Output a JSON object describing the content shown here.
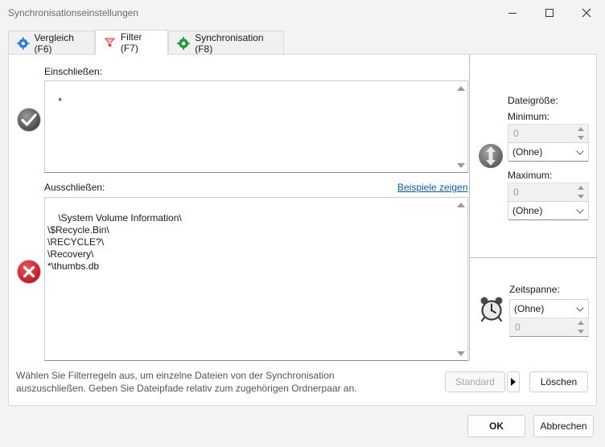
{
  "window": {
    "title": "Synchronisationseinstellungen"
  },
  "tabs": [
    {
      "label": "Vergleich (F6)",
      "icon": "gear-blue-icon"
    },
    {
      "label": "Filter (F7)",
      "icon": "funnel-red-icon",
      "active": true
    },
    {
      "label": "Synchronisation (F8)",
      "icon": "gear-green-icon"
    }
  ],
  "include": {
    "label": "Einschließen:",
    "text": "*"
  },
  "exclude": {
    "label": "Ausschließen:",
    "examples_link": "Beispiele zeigen",
    "text": "\\System Volume Information\\\n\\$Recycle.Bin\\\n\\RECYCLE?\\\n\\Recovery\\\n*\\thumbs.db"
  },
  "filesize": {
    "label": "Dateigröße:",
    "min_label": "Minimum:",
    "min_value": "0",
    "min_unit": "(Ohne)",
    "max_label": "Maximum:",
    "max_value": "0",
    "max_unit": "(Ohne)"
  },
  "timespan": {
    "label": "Zeitspanne:",
    "select": "(Ohne)",
    "value": "0"
  },
  "hint": "Wählen Sie Filterregeln aus, um einzelne Dateien von der Synchronisation\nauszuschließen. Geben Sie Dateipfade relativ zum zugehörigen Ordnerpaar an.",
  "buttons": {
    "standard": "Standard",
    "clear": "Löschen",
    "ok": "OK",
    "cancel": "Abbrechen"
  },
  "colors": {
    "accent": "#0a5eb5",
    "exclude_red": "#d8232a",
    "include_gray": "#6f6f6f"
  }
}
